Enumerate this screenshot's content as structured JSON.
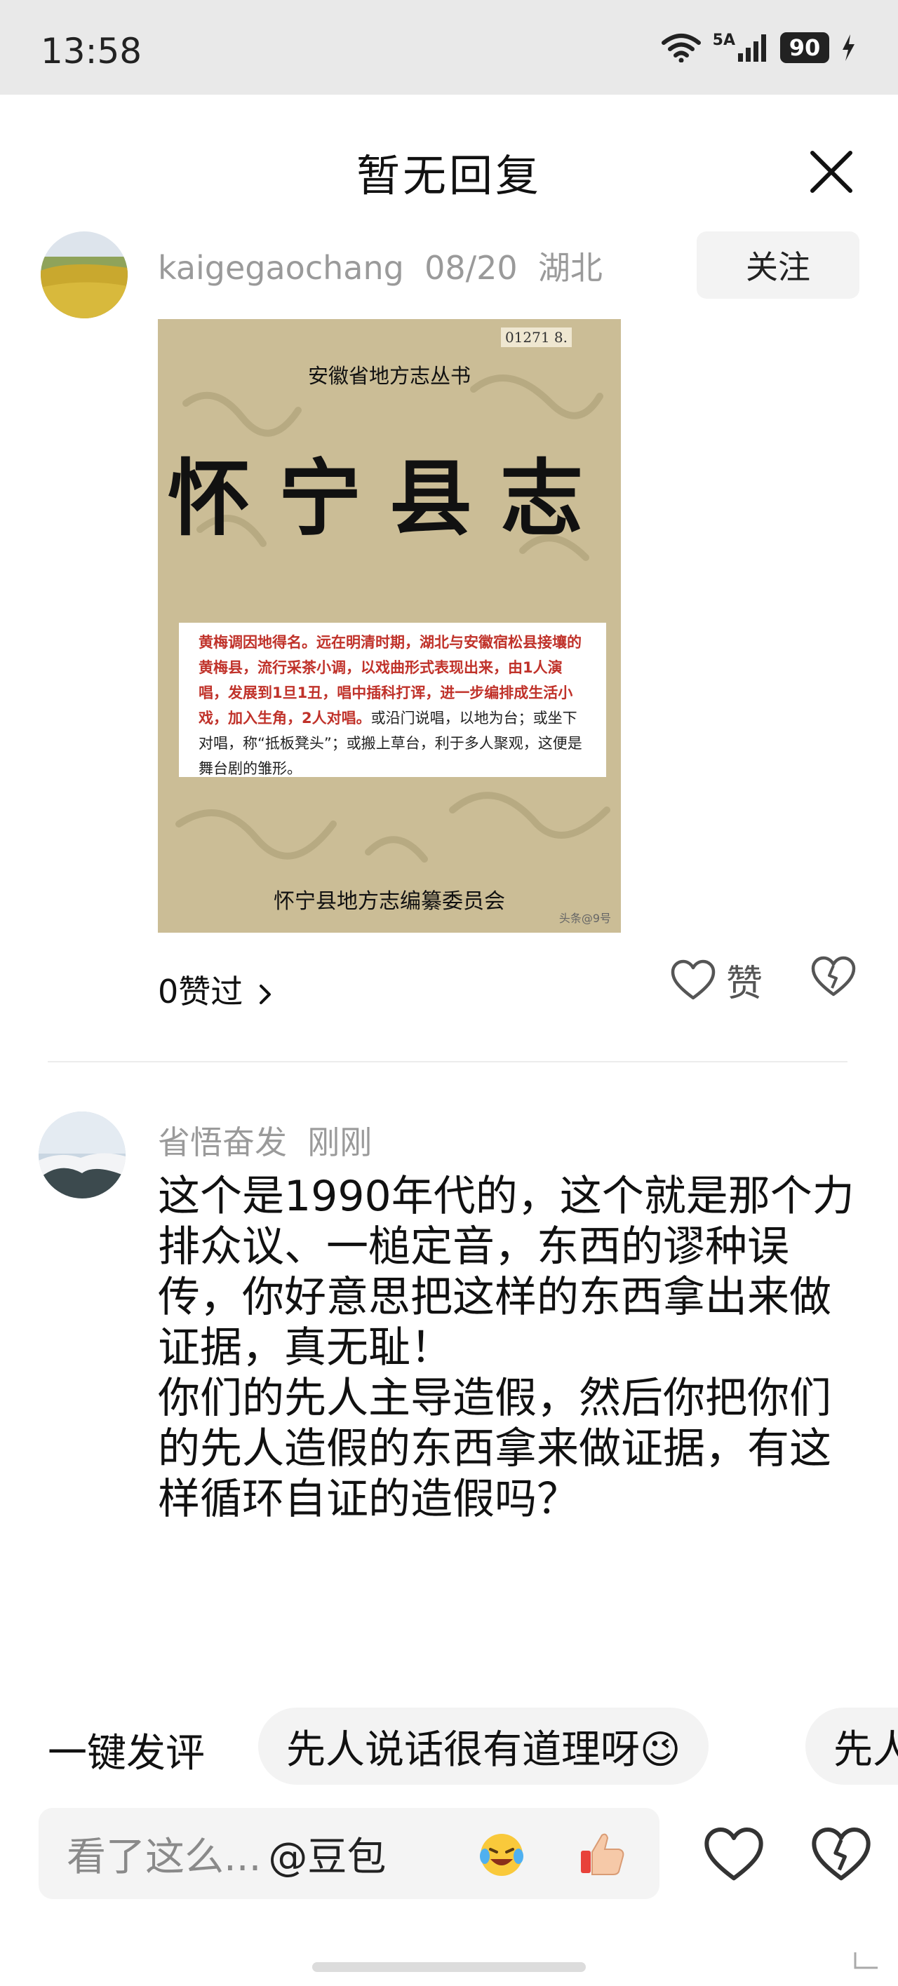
{
  "status_bar": {
    "time": "13:58",
    "network": "5A",
    "battery": "90"
  },
  "header": {
    "title": "暂无回复"
  },
  "reply": {
    "username": "kaigegaochang",
    "date": "08/20",
    "location": "湖北",
    "follow_label": "关注",
    "image": {
      "doc_id": "01271 8.",
      "series": "安徽省地方志丛书",
      "title": "怀宁县志",
      "excerpt_red": "黄梅调因地得名。远在明清时期，湖北与安徽宿松县接壤的黄梅县，流行采茶小调，以戏曲形式表现出来，由1人演唱，发展到1旦1丑，唱中插科打诨，进一步编排成生活小戏，加入生角，2人对唱。",
      "excerpt_black": "或沿门说唱，以地为台；或坐下对唱，称“抵板凳头”；或搬上草台，利于多人聚观，这便是舞台剧的雏形。",
      "publisher": "怀宁县地方志编纂委员会",
      "watermark": "头条@9号"
    },
    "likes_text": "0赞过",
    "like_label": "赞"
  },
  "comment": {
    "username": "省悟奋发",
    "time": "刚刚",
    "text": "这个是1990年代的，这个就是那个力排众议、一槌定音，东西的谬种误传，你好意思把这样的东西拿出来做证据，真无耻！\n你们的先人主导造假，然后你把你们的先人造假的东西拿来做证据，有这样循环自证的造假吗？"
  },
  "quick_comment": {
    "label": "一键发评",
    "chips": [
      "先人说话很有道理呀😉",
      "先人"
    ]
  },
  "input": {
    "placeholder": "看了这么...",
    "mention": "@豆包"
  },
  "colors": {
    "accent_red": "#c0322a",
    "muted_gray": "#9a9a9a",
    "status_bg": "#e9e9e9"
  }
}
